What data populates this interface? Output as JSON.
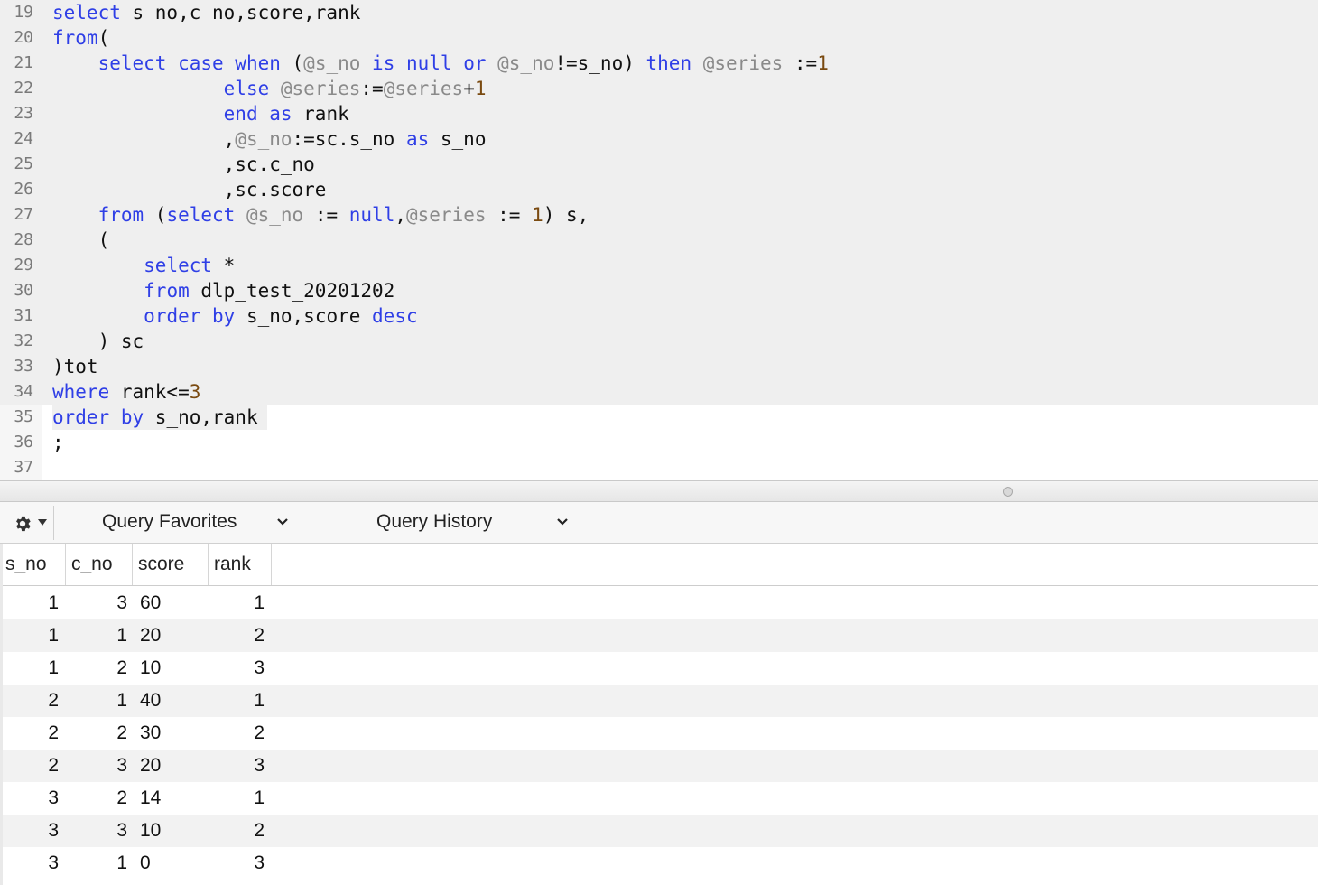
{
  "editor": {
    "lines": [
      {
        "num": "19",
        "tokens": [
          [
            "kw",
            "select"
          ],
          [
            "tx",
            " s_no,c_no,score,rank"
          ]
        ]
      },
      {
        "num": "20",
        "tokens": [
          [
            "kw",
            "from"
          ],
          [
            "tx",
            "("
          ]
        ]
      },
      {
        "num": "21",
        "tokens": [
          [
            "tx",
            "    "
          ],
          [
            "kw",
            "select case when"
          ],
          [
            "tx",
            " ("
          ],
          [
            "var",
            "@s_no"
          ],
          [
            "tx",
            " "
          ],
          [
            "kw",
            "is null or"
          ],
          [
            "tx",
            " "
          ],
          [
            "var",
            "@s_no"
          ],
          [
            "tx",
            "!=s_no) "
          ],
          [
            "kw",
            "then"
          ],
          [
            "tx",
            " "
          ],
          [
            "var",
            "@series"
          ],
          [
            "tx",
            " :="
          ],
          [
            "num",
            "1"
          ]
        ]
      },
      {
        "num": "22",
        "tokens": [
          [
            "tx",
            "               "
          ],
          [
            "kw",
            "else"
          ],
          [
            "tx",
            " "
          ],
          [
            "var",
            "@series"
          ],
          [
            "tx",
            ":="
          ],
          [
            "var",
            "@series"
          ],
          [
            "tx",
            "+"
          ],
          [
            "num",
            "1"
          ]
        ]
      },
      {
        "num": "23",
        "tokens": [
          [
            "tx",
            "               "
          ],
          [
            "kw",
            "end as"
          ],
          [
            "tx",
            " rank"
          ]
        ]
      },
      {
        "num": "24",
        "tokens": [
          [
            "tx",
            "               ,"
          ],
          [
            "var",
            "@s_no"
          ],
          [
            "tx",
            ":=sc.s_no "
          ],
          [
            "kw",
            "as"
          ],
          [
            "tx",
            " s_no"
          ]
        ]
      },
      {
        "num": "25",
        "tokens": [
          [
            "tx",
            "               ,sc.c_no"
          ]
        ]
      },
      {
        "num": "26",
        "tokens": [
          [
            "tx",
            "               ,sc.score"
          ]
        ]
      },
      {
        "num": "27",
        "tokens": [
          [
            "tx",
            "    "
          ],
          [
            "kw",
            "from"
          ],
          [
            "tx",
            " ("
          ],
          [
            "kw",
            "select"
          ],
          [
            "tx",
            " "
          ],
          [
            "var",
            "@s_no"
          ],
          [
            "tx",
            " := "
          ],
          [
            "kw",
            "null"
          ],
          [
            "tx",
            ","
          ],
          [
            "var",
            "@series"
          ],
          [
            "tx",
            " := "
          ],
          [
            "num",
            "1"
          ],
          [
            "tx",
            ") s,"
          ]
        ]
      },
      {
        "num": "28",
        "tokens": [
          [
            "tx",
            "    ("
          ]
        ]
      },
      {
        "num": "29",
        "tokens": [
          [
            "tx",
            "        "
          ],
          [
            "kw",
            "select"
          ],
          [
            "tx",
            " *"
          ]
        ]
      },
      {
        "num": "30",
        "tokens": [
          [
            "tx",
            "        "
          ],
          [
            "kw",
            "from"
          ],
          [
            "tx",
            " dlp_test_20201202"
          ]
        ]
      },
      {
        "num": "31",
        "tokens": [
          [
            "tx",
            "        "
          ],
          [
            "kw",
            "order by"
          ],
          [
            "tx",
            " s_no,score "
          ],
          [
            "kw",
            "desc"
          ]
        ]
      },
      {
        "num": "32",
        "tokens": [
          [
            "tx",
            "    ) sc"
          ]
        ]
      },
      {
        "num": "33",
        "tokens": [
          [
            "tx",
            ")tot"
          ]
        ]
      },
      {
        "num": "34",
        "tokens": [
          [
            "kw",
            "where"
          ],
          [
            "tx",
            " rank<="
          ],
          [
            "num",
            "3"
          ]
        ]
      },
      {
        "num": "35",
        "tokens": [
          [
            "kw",
            "order by"
          ],
          [
            "tx",
            " s_no,rank"
          ]
        ]
      },
      {
        "num": "36",
        "tokens": [
          [
            "tx",
            ";"
          ]
        ]
      },
      {
        "num": "37",
        "tokens": []
      }
    ]
  },
  "toolbar": {
    "gear_icon": "gear-icon",
    "query_favorites_label": "Query Favorites",
    "query_history_label": "Query History"
  },
  "results": {
    "columns": [
      "s_no",
      "c_no",
      "score",
      "rank"
    ],
    "rows": [
      [
        "1",
        "3",
        "60",
        "1"
      ],
      [
        "1",
        "1",
        "20",
        "2"
      ],
      [
        "1",
        "2",
        "10",
        "3"
      ],
      [
        "2",
        "1",
        "40",
        "1"
      ],
      [
        "2",
        "2",
        "30",
        "2"
      ],
      [
        "2",
        "3",
        "20",
        "3"
      ],
      [
        "3",
        "2",
        "14",
        "1"
      ],
      [
        "3",
        "3",
        "10",
        "2"
      ],
      [
        "3",
        "1",
        "0",
        "3"
      ]
    ]
  }
}
